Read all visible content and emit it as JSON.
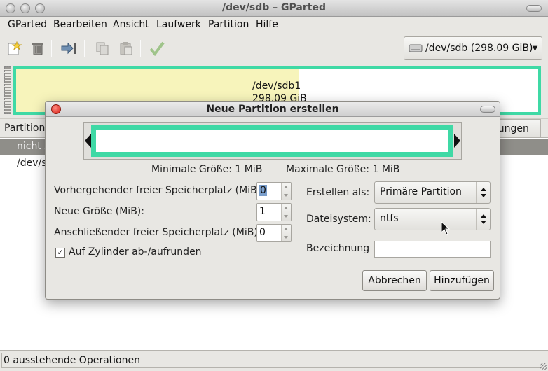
{
  "window": {
    "title": "/dev/sdb – GParted"
  },
  "menubar": {
    "items": [
      {
        "label": "GParted"
      },
      {
        "label": "Bearbeiten"
      },
      {
        "label": "Ansicht"
      },
      {
        "label": "Laufwerk"
      },
      {
        "label": "Partition"
      },
      {
        "label": "Hilfe"
      }
    ]
  },
  "toolbar": {
    "buttons": [
      {
        "icon": "new-icon"
      },
      {
        "icon": "delete-icon"
      },
      {
        "icon": "resize-move-icon"
      },
      {
        "icon": "copy-icon"
      },
      {
        "icon": "paste-icon"
      },
      {
        "icon": "apply-icon"
      }
    ],
    "device": {
      "label": "/dev/sdb  (298.09 GiB)",
      "icon": "harddisk-icon"
    }
  },
  "graph": {
    "partition_name": "/dev/sdb1",
    "partition_size": "298.09 GiB",
    "border_color": "#3fd9a5",
    "used_color": "#f7f4bb"
  },
  "list": {
    "header_first": "Partition",
    "header_last": "rungen",
    "rows": [
      {
        "cell": "nicht z"
      },
      {
        "cell": "/dev/sc"
      }
    ]
  },
  "statusbar": {
    "text": "0 ausstehende Operationen"
  },
  "dialog": {
    "title": "Neue Partition erstellen",
    "min_size": "Minimale Größe: 1 MiB",
    "max_size": "Maximale Größe: 1 MiB",
    "fields": {
      "preceding_label": "Vorhergehender freier Speicherplatz (MiB):",
      "preceding_value": "0",
      "new_size_label": "Neue Größe (MiB):",
      "new_size_value": "1",
      "following_label": "Anschließender freier Speicherplatz (MiB):",
      "following_value": "0",
      "round_label": "Auf Zylinder ab-/aufrunden",
      "round_checked": true,
      "create_as_label": "Erstellen als:",
      "create_as_value": "Primäre Partition",
      "filesystem_label": "Dateisystem:",
      "filesystem_value": "ntfs",
      "label_label": "Bezeichnung",
      "label_value": ""
    },
    "buttons": {
      "cancel": "Abbrechen",
      "add": "Hinzufügen"
    }
  }
}
